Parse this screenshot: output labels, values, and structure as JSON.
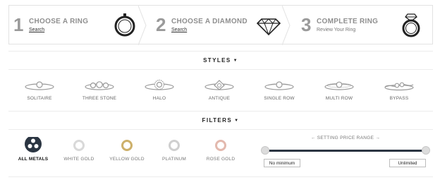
{
  "steps": [
    {
      "num": "1",
      "title": "CHOOSE A RING",
      "sub": "Search",
      "icon": "ring-icon"
    },
    {
      "num": "2",
      "title": "CHOOSE A DIAMOND",
      "sub": "Search",
      "icon": "diamond-icon"
    },
    {
      "num": "3",
      "title": "COMPLETE RING",
      "sub": "Review Your Ring",
      "icon": "diamond-ring-icon"
    }
  ],
  "styles_header": {
    "label": "STYLES",
    "caret": "▼"
  },
  "styles": [
    {
      "label": "SOLITAIRE",
      "icon": "solitaire-ring-icon"
    },
    {
      "label": "THREE STONE",
      "icon": "three-stone-ring-icon"
    },
    {
      "label": "HALO",
      "icon": "halo-ring-icon"
    },
    {
      "label": "ANTIQUE",
      "icon": "antique-ring-icon"
    },
    {
      "label": "SINGLE ROW",
      "icon": "single-row-ring-icon"
    },
    {
      "label": "MULTI ROW",
      "icon": "multi-row-ring-icon"
    },
    {
      "label": "BYPASS",
      "icon": "bypass-ring-icon"
    }
  ],
  "filters_header": {
    "label": "FILTERS",
    "caret": "▼"
  },
  "metals": [
    {
      "label": "ALL METALS",
      "active": true
    },
    {
      "label": "WHITE GOLD",
      "color": "#d9d9d9"
    },
    {
      "label": "YELLOW GOLD",
      "color": "#cdb06a"
    },
    {
      "label": "PLATINUM",
      "color": "#cfcfcf"
    },
    {
      "label": "ROSE GOLD",
      "color": "#e3b9ae"
    }
  ],
  "price": {
    "title": "←  SETTING PRICE RANGE  →",
    "min": "No minimum",
    "max": "Unlimited"
  },
  "colors": {
    "track": "#2b3542",
    "step_text": "#8f8f8f"
  }
}
